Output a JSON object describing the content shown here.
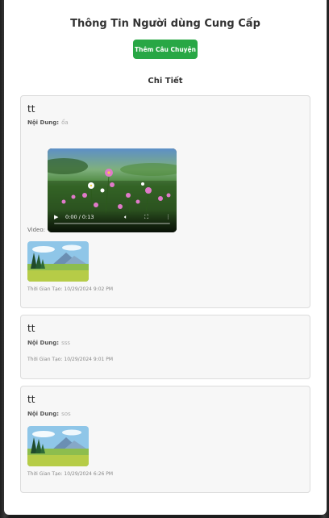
{
  "modal": {
    "title": "Thông Tin Người dùng Cung Cấp",
    "add_story_button": "Thêm Câu Chuyện",
    "section_title": "Chi Tiết"
  },
  "labels": {
    "content": "Nội Dung:",
    "video": "Video:",
    "created": "Thời Gian Tạo:"
  },
  "stories": [
    {
      "title": "tt",
      "content": "ổa",
      "video": {
        "time": "0:00 / 0:13",
        "progress": 0
      },
      "has_image": true,
      "created_at": "10/29/2024 9:02 PM"
    },
    {
      "title": "tt",
      "content": "sss",
      "has_image": false,
      "created_at": "10/29/2024 9:01 PM"
    },
    {
      "title": "tt",
      "content": "sos",
      "has_image": true,
      "created_at": "10/29/2024 6:26 PM"
    }
  ],
  "colors": {
    "accent_button": "#28a745",
    "card_background": "#f7f7f7",
    "card_border": "#dcdcdc"
  },
  "icons": [
    "play-icon",
    "volume-icon",
    "fullscreen-icon",
    "more-options-icon"
  ]
}
